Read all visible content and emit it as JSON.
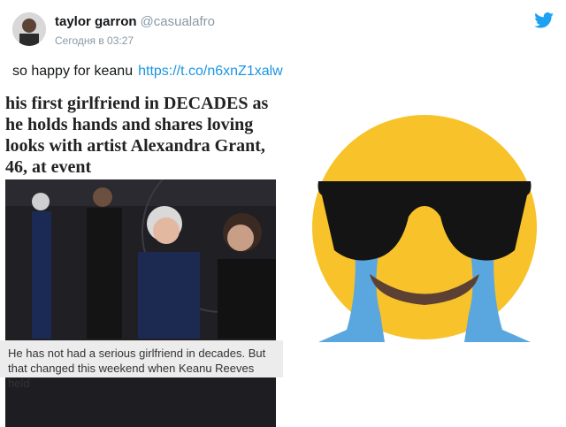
{
  "tweet": {
    "display_name": "taylor garron",
    "handle": "@casualafro",
    "timestamp": "Сегодня в 03:27",
    "text": "so happy for keanu",
    "link": "https://t.co/n6xnZ1xalw"
  },
  "article": {
    "headline": "his first girlfriend in DECADES as he holds hands and shares loving looks with artist Alexandra Grant, 46, at event",
    "caption": "He has not had a serious girlfriend in decades. But that changed this weekend when Keanu Reeves held"
  },
  "colors": {
    "twitter_blue": "#1da1f2",
    "emoji_yellow": "#f8c22a",
    "tear_blue": "#5aa7e0",
    "link_blue": "#1b95e0"
  },
  "icons": {
    "brand": "twitter-bird-icon",
    "emoji": "cool-crying-emoji"
  }
}
